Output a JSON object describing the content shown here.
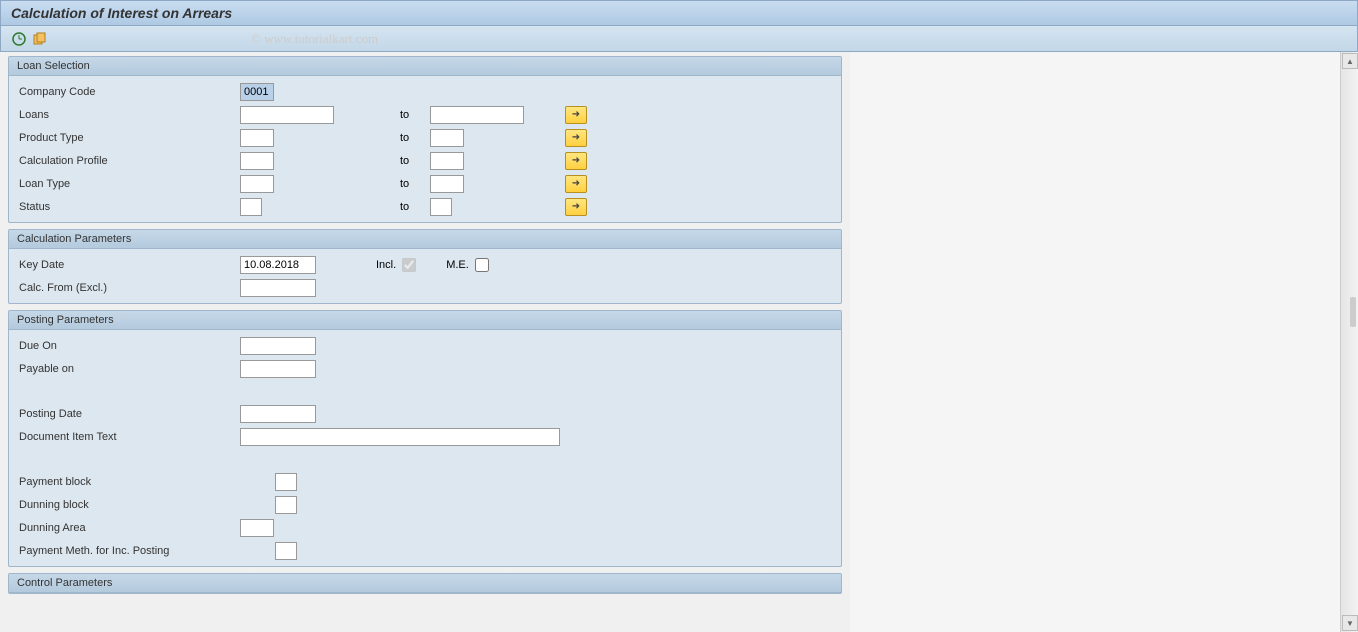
{
  "title": "Calculation of Interest on Arrears",
  "watermark": "© www.tutorialkart.com",
  "groups": {
    "g1": {
      "title": "Loan Selection",
      "company_code_lbl": "Company Code",
      "company_code_val": "0001",
      "loans_lbl": "Loans",
      "product_type_lbl": "Product Type",
      "calc_profile_lbl": "Calculation Profile",
      "loan_type_lbl": "Loan Type",
      "status_lbl": "Status",
      "to_lbl": "to"
    },
    "g2": {
      "title": "Calculation Parameters",
      "key_date_lbl": "Key Date",
      "key_date_val": "10.08.2018",
      "incl_lbl": "Incl.",
      "me_lbl": "M.E.",
      "calc_from_lbl": "Calc. From (Excl.)"
    },
    "g3": {
      "title": "Posting Parameters",
      "due_on_lbl": "Due On",
      "payable_on_lbl": "Payable on",
      "posting_date_lbl": "Posting Date",
      "doc_item_text_lbl": "Document Item Text",
      "payment_block_lbl": "Payment block",
      "dunning_block_lbl": "Dunning block",
      "dunning_area_lbl": "Dunning Area",
      "payment_meth_lbl": "Payment Meth. for Inc. Posting"
    },
    "g4": {
      "title": "Control Parameters"
    }
  }
}
